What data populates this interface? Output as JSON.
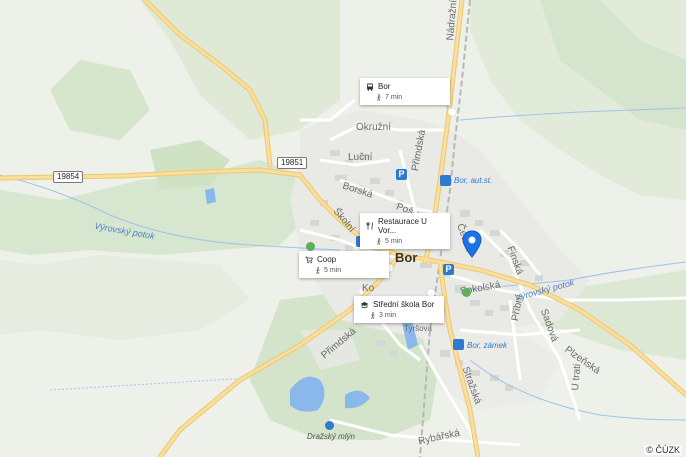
{
  "map": {
    "town_label": "Bor",
    "copyright": "© ČÚZK",
    "streets": {
      "nadrazni": "Nádražní",
      "okruzni": "Okružní",
      "lucni": "Luční",
      "borska": "Borská",
      "skolni": "Školní",
      "primdska_top": "Přimdská",
      "primdska_bottom": "Přimdská",
      "ceska": "Česká",
      "finska": "Finská",
      "sokolska": "Sokolská",
      "pribni": "Příbní",
      "sadova": "Sadová",
      "plzenska": "Plzeňská",
      "u_trati": "U trati",
      "strazska": "Stražská",
      "rybarska": "Rybářská",
      "tyrsova": "Tyršova",
      "posta": "Poš",
      "ko": "Ko"
    },
    "water": {
      "vyrovsky_left": "Výrovský potok",
      "vyrovsky_right": "Výrovský potok"
    },
    "route_numbers": [
      "19854",
      "19851"
    ],
    "places": {
      "bor_aut_st": "Bor, aut.st.",
      "bor_zamek": "Bor, zámek",
      "drazsky_mlyn": "Dražský mlýn"
    },
    "poi_cards": [
      {
        "id": "bus",
        "title": "Bor",
        "distance": "7 min",
        "icon": "bus-icon"
      },
      {
        "id": "restaurant",
        "title": "Restaurace U Vor...",
        "distance": "5 min",
        "icon": "fork-knife-icon"
      },
      {
        "id": "coop",
        "title": "Coop",
        "distance": "5 min",
        "icon": "cart-icon"
      },
      {
        "id": "school",
        "title": "Střední škola Bor",
        "distance": "3 min",
        "icon": "graduation-cap-icon"
      }
    ],
    "colors": {
      "pin": "#1a73e8",
      "road_main": "#f5d38a",
      "forest": "#cfe3c4",
      "water": "#7fb0e8"
    }
  }
}
